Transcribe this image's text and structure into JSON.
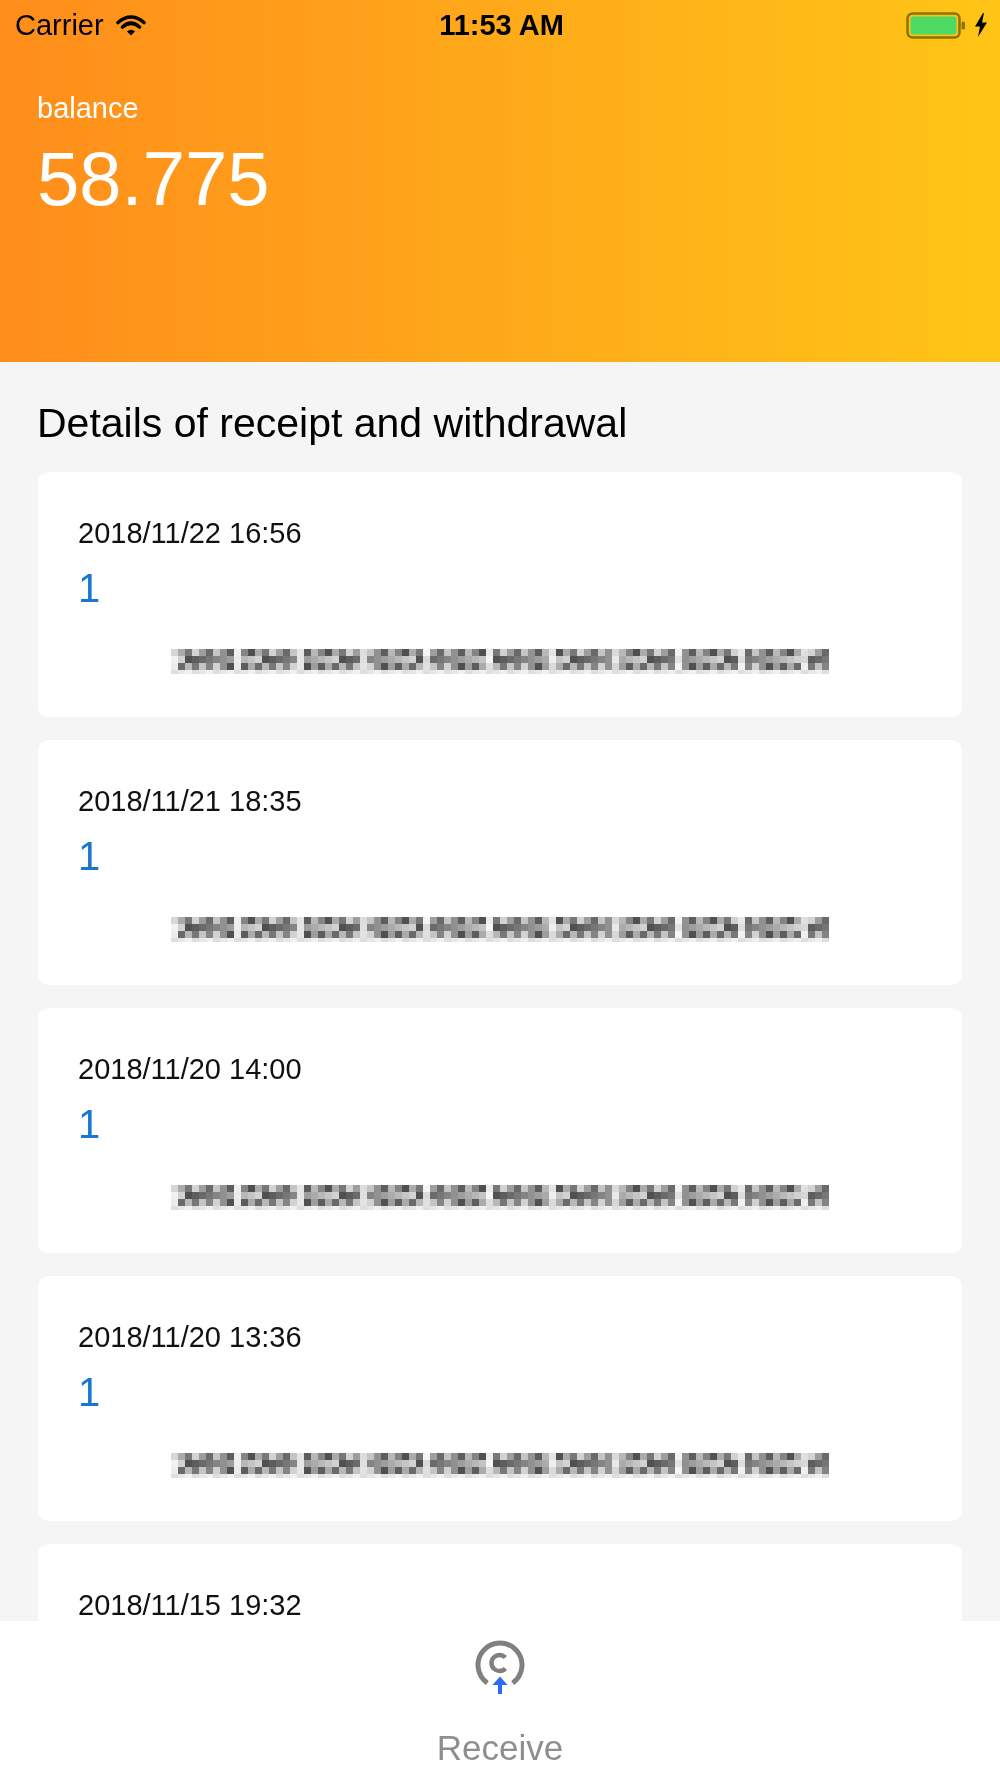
{
  "status_bar": {
    "carrier": "Carrier",
    "time": "11:53 AM"
  },
  "header": {
    "label": "balance",
    "balance": "58.775"
  },
  "section_title": "Details of receipt and withdrawal",
  "transactions": [
    {
      "time": "2018/11/22 16:56",
      "amount": "1",
      "redacted_address": true
    },
    {
      "time": "2018/11/21 18:35",
      "amount": "1",
      "redacted_address": true
    },
    {
      "time": "2018/11/20 14:00",
      "amount": "1",
      "redacted_address": true
    },
    {
      "time": "2018/11/20 13:36",
      "amount": "1",
      "redacted_address": true
    },
    {
      "time": "2018/11/15 19:32"
    }
  ],
  "bottom_bar": {
    "action": "Receive"
  }
}
